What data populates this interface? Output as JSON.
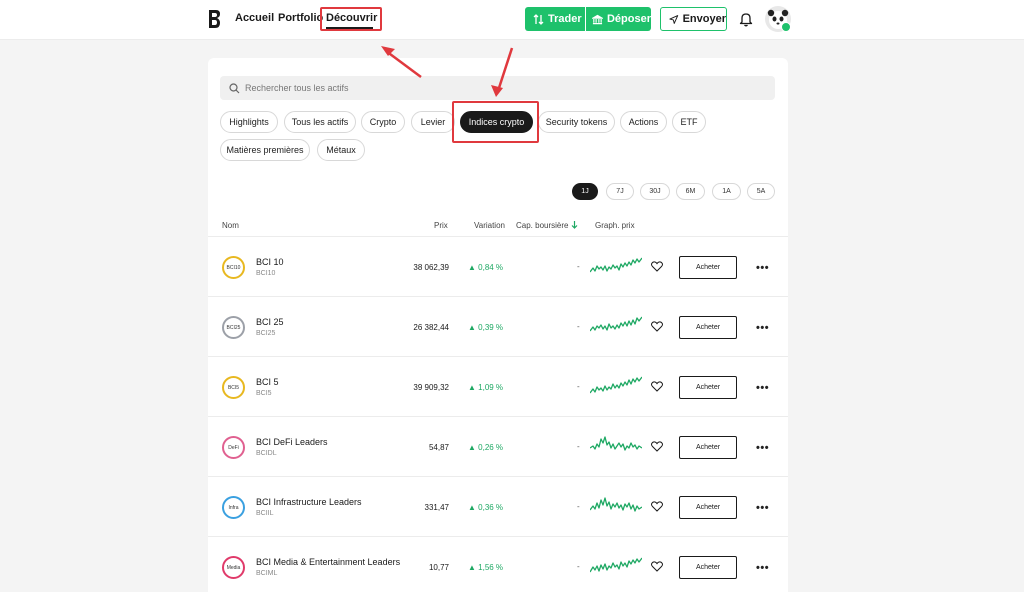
{
  "header": {
    "nav": [
      "Accueil",
      "Portfolio",
      "Découvrir"
    ],
    "trader_label": "Trader",
    "deposer_label": "Déposer",
    "envoyer_label": "Envoyer"
  },
  "search": {
    "placeholder": "Rechercher tous les actifs"
  },
  "categories": [
    "Highlights",
    "Tous les actifs",
    "Crypto",
    "Levier",
    "Indices crypto",
    "Security tokens",
    "Actions",
    "ETF",
    "Matières premières",
    "Métaux"
  ],
  "active_category": "Indices crypto",
  "periods": [
    "1J",
    "7J",
    "30J",
    "6M",
    "1A",
    "5A"
  ],
  "active_period": "1J",
  "table": {
    "headers": {
      "name": "Nom",
      "price": "Prix",
      "change": "Variation",
      "cap": "Cap. boursière",
      "chart": "Graph. prix"
    },
    "rows": [
      {
        "name": "BCI 10",
        "ticker": "BCI10",
        "logo": "BCI10",
        "price": "38 062,39",
        "change": "▲ 0,84 %",
        "cap": "-",
        "buy": "Acheter"
      },
      {
        "name": "BCI 25",
        "ticker": "BCI25",
        "logo": "BCI25",
        "price": "26 382,44",
        "change": "▲ 0,39 %",
        "cap": "-",
        "buy": "Acheter"
      },
      {
        "name": "BCI 5",
        "ticker": "BCI5",
        "logo": "BCI5",
        "price": "39 909,32",
        "change": "▲ 1,09 %",
        "cap": "-",
        "buy": "Acheter"
      },
      {
        "name": "BCI DeFi Leaders",
        "ticker": "BCIDL",
        "logo": "DeFi",
        "price": "54,87",
        "change": "▲ 0,26 %",
        "cap": "-",
        "buy": "Acheter"
      },
      {
        "name": "BCI Infrastructure Leaders",
        "ticker": "BCIIL",
        "logo": "Infra",
        "price": "331,47",
        "change": "▲ 0,36 %",
        "cap": "-",
        "buy": "Acheter"
      },
      {
        "name": "BCI Media & Entertainment Leaders",
        "ticker": "BCIML",
        "logo": "Media",
        "price": "10,77",
        "change": "▲ 1,56 %",
        "cap": "-",
        "buy": "Acheter"
      }
    ]
  },
  "colors": {
    "accent": "#1ec16b",
    "positive": "#1ea863",
    "highlight": "#e0393e"
  },
  "icons": [
    "bitpanda-logo",
    "trade-arrows-icon",
    "bank-icon",
    "send-icon",
    "bell-icon",
    "avatar-panda",
    "search-icon",
    "heart-icon",
    "more-icon",
    "sort-down-icon"
  ]
}
